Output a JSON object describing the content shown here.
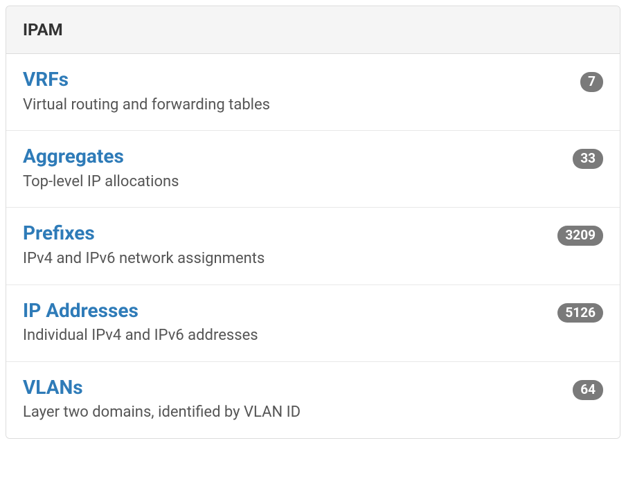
{
  "panel": {
    "title": "IPAM",
    "items": [
      {
        "title": "VRFs",
        "description": "Virtual routing and forwarding tables",
        "count": "7"
      },
      {
        "title": "Aggregates",
        "description": "Top-level IP allocations",
        "count": "33"
      },
      {
        "title": "Prefixes",
        "description": "IPv4 and IPv6 network assignments",
        "count": "3209"
      },
      {
        "title": "IP Addresses",
        "description": "Individual IPv4 and IPv6 addresses",
        "count": "5126"
      },
      {
        "title": "VLANs",
        "description": "Layer two domains, identified by VLAN ID",
        "count": "64"
      }
    ]
  }
}
